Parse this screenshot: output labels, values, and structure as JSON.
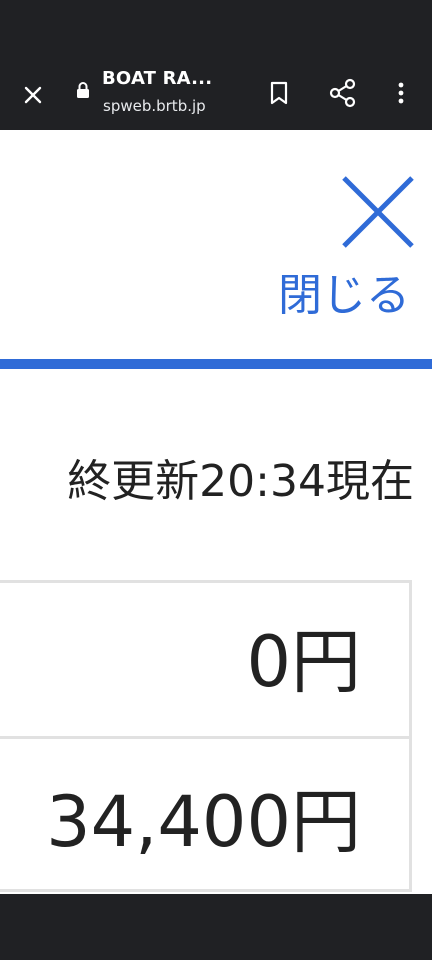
{
  "browser": {
    "title": "BOAT RA...",
    "url": "spweb.brtb.jp"
  },
  "panel": {
    "close_label": "閉じる",
    "update_text": "終更新20:34現在"
  },
  "table": {
    "rows": [
      {
        "value": "0円"
      },
      {
        "value": "34,400円"
      }
    ]
  },
  "colors": {
    "accent": "#2f6bd7",
    "toolbar_bg": "#202124",
    "text": "#222222",
    "border": "#e1e1e1"
  },
  "icons": [
    "close-icon",
    "lock-icon",
    "bookmark-icon",
    "share-icon",
    "more-vert-icon",
    "close-x-icon"
  ]
}
